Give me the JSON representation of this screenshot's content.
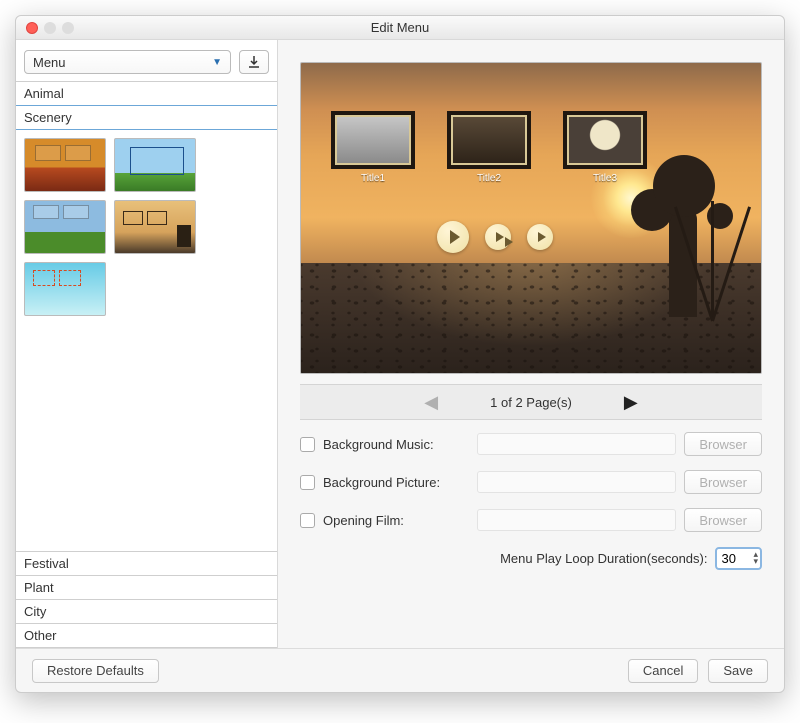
{
  "window": {
    "title": "Edit Menu"
  },
  "sidebar": {
    "dropdown": "Menu",
    "categories_top": [
      "Animal",
      "Scenery"
    ],
    "active_category": "Scenery",
    "categories_bottom": [
      "Festival",
      "Plant",
      "City",
      "Other"
    ]
  },
  "preview": {
    "titles": [
      "Title1",
      "Title2",
      "Title3"
    ]
  },
  "pager": {
    "label": "1 of 2 Page(s)",
    "prev_enabled": false,
    "next_enabled": true
  },
  "form": {
    "bg_music_label": "Background Music:",
    "bg_music_checked": false,
    "bg_picture_label": "Background Picture:",
    "bg_picture_checked": false,
    "opening_film_label": "Opening Film:",
    "opening_film_checked": false,
    "browser_label": "Browser",
    "loop_label": "Menu Play Loop Duration(seconds):",
    "loop_value": "30"
  },
  "footer": {
    "restore": "Restore Defaults",
    "cancel": "Cancel",
    "save": "Save"
  }
}
